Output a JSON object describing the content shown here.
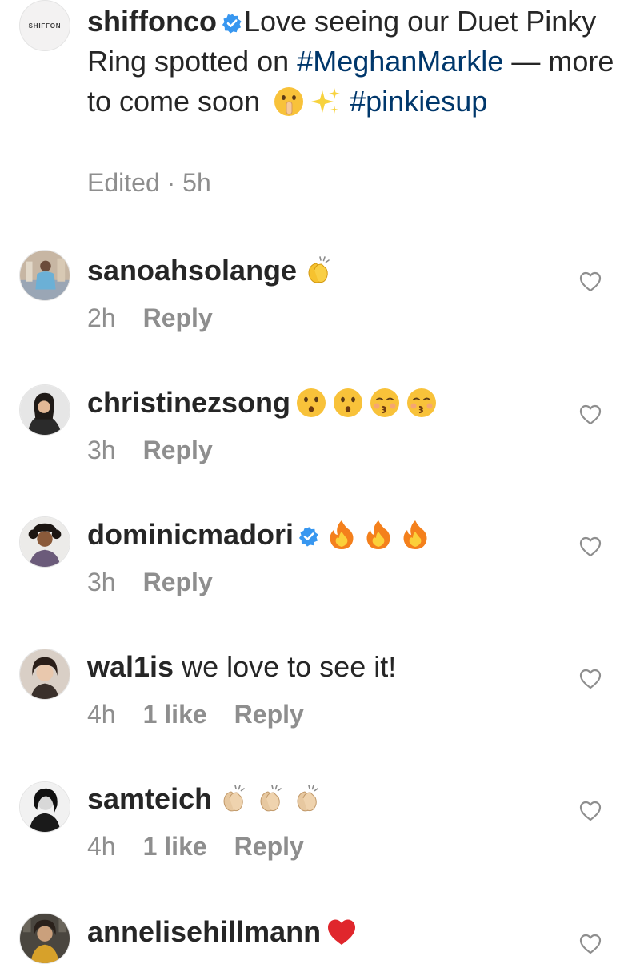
{
  "post": {
    "author": "shiffonco",
    "avatar_logo": "SHIFFON",
    "caption_part1": "Love seeing our Duet Pinky Ring spotted on ",
    "hashtag1": "#MeghanMarkle",
    "caption_part2": " — more to come soon ",
    "emoji_shush": "🤫",
    "emoji_sparkles": "✨",
    "hashtag2": "#pinkiesup",
    "edited_label": "Edited",
    "separator": "·",
    "time": "5h"
  },
  "comments": [
    {
      "username": "sanoahsolange",
      "emoji_icons": [
        "clapping-hands"
      ],
      "time": "2h",
      "likes": "",
      "reply": "Reply"
    },
    {
      "username": "christinezsong",
      "emoji_icons": [
        "hushed-face",
        "hushed-face",
        "kissing-face",
        "kissing-face"
      ],
      "time": "3h",
      "likes": "",
      "reply": "Reply"
    },
    {
      "username": "dominicmadori",
      "verified": true,
      "emoji_icons": [
        "fire",
        "fire",
        "fire"
      ],
      "time": "3h",
      "likes": "",
      "reply": "Reply"
    },
    {
      "username": "wal1is",
      "text": "we love to see it!",
      "time": "4h",
      "likes": "1 like",
      "reply": "Reply"
    },
    {
      "username": "samteich",
      "emoji_icons": [
        "clapping-hands-light",
        "clapping-hands-light",
        "clapping-hands-light"
      ],
      "time": "4h",
      "likes": "1 like",
      "reply": "Reply"
    },
    {
      "username": "annelisehillmann",
      "emoji_icons": [
        "red-heart"
      ],
      "time": "",
      "likes": "",
      "reply": ""
    }
  ],
  "colors": {
    "text": "#262626",
    "secondary": "#8e8e8e",
    "hashtag": "#00376b",
    "verified": "#3897f0",
    "divider": "#e3e3e3"
  }
}
